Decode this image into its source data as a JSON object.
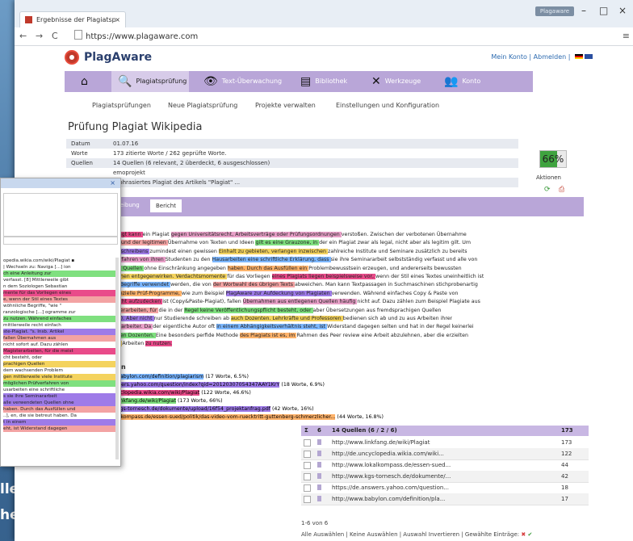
{
  "desktop": {
    "line1": "lle mit",
    "line2": "helle Ein-"
  },
  "browser": {
    "tab_title": "Ergebnisse der Plagiatsp",
    "tab_close": "×",
    "user_chip": "Plagaware",
    "min": "–",
    "max": "□",
    "close": "×",
    "url": "https://www.plagaware.com",
    "nav": {
      "back": "←",
      "forward": "→",
      "reload": "C"
    },
    "menu": "≡"
  },
  "site": {
    "brand": "PlagAware",
    "links": {
      "account": "Mein Konto",
      "sep": " | ",
      "logout": "Abmelden",
      "sep2": " | "
    },
    "mainnav": [
      {
        "icon": "home-icon",
        "glyph": "⌂",
        "label": ""
      },
      {
        "icon": "search-icon",
        "glyph": "🔍",
        "label": "Plagiatsprüfung"
      },
      {
        "icon": "eye-icon",
        "glyph": "👁",
        "label": "Text-Überwachung"
      },
      {
        "icon": "library-icon",
        "glyph": "▤",
        "label": "Bibliothek"
      },
      {
        "icon": "tools-icon",
        "glyph": "✕",
        "label": "Werkzeuge"
      },
      {
        "icon": "account-icon",
        "glyph": "👥",
        "label": "Konto"
      }
    ],
    "subnav": [
      "Plagiatsprüfungen",
      "Neue Plagiatsprüfung",
      "Projekte verwalten",
      "Einstellungen und Konfiguration"
    ],
    "page_title": "Prüfung Plagiat Wikipedia"
  },
  "info": {
    "datum_label": "Datum",
    "datum": "01.07.16",
    "worte_label": "Worte",
    "worte": "173 zitierte Worte / 262 geprüfte Worte.",
    "quellen_label": "Quellen",
    "quellen": "14 Quellen (6 relevant, 2 überdeckt, 6 ausgeschlossen)",
    "projekt": "emoprojekt",
    "beschreibung": "raphrasiertes Plagiat des Artikels \"Plagiat\" ...",
    "percent": "66%",
    "aktionen": "Aktionen"
  },
  "tabs": [
    "schreibung",
    "Bericht"
  ],
  "report": {
    "heading": "ext",
    "lines": [
      "Unbefugt kann ein Plagiat gegen Universitätsrecht, Arbeitsverträge oder Prüfungsordnungen verstoßen. Zwischen der verbotenen Übernahme",
      "ungen und der legitimen Übernahme von Texten und Ideen gilt es eine Grauzone, in der ein Plagiat zwar als legal, nicht aber als legitim gilt. Um",
      "des Abschreibens zumindest einen gewissen Einhalt zu gebieten, verlangen inzwischen zahlreiche Institute und Seminare zusätzlich zu bereits",
      "Prüfverfahren von ihren Studenten zu den Hausarbeiten eine schriftliche Erklärung, dass sie ihre Seminararbeit selbstständig verfasst und alle von",
      "ndeten Quellen ohne Einschränkung angegeben haben. Durch das Ausfüllen ein Problembewusstsein erzeugen, und andererseits bewussten",
      "versuchen entgegenwirken. Verdachtsmomente für das Vorliegen eines Plagiats liegen beispielsweise vor, wenn der Stil eines Textes uneinheitlich ist",
      "tische Begriffe verwendet werden, die von der Wortwahl des übrigen Texts abweichen. Man kann Textpassagen in Suchmaschinen stichprobenartig",
      "der spezielle Prüf-Programme, wie zum Beispiel PlagAware zur Aufdeckung von Plagiaten verwenden. Während einfaches Copy & Paste von",
      "cht leicht aufzudecken ist (Copy&Paste-Plagiat), fallen Übernahmen aus entlegenen Quellen häufig nicht auf. Dazu zählen zum Beispiel Plagiate aus",
      "Magisterarbeiten, für die in der Regel keine Veröffentlichungspflicht besteht, oder aber Übersetzungen aus fremdsprachigen Quellen",
      "plagiat). Aber nicht nur Studierende schreiben ab auch Dozenten. Lehrkräfte und Professoren bedienen sich ab und zu aus Arbeiten ihrer",
      "der Mitarbeiter. Da der eigentliche Autor oft in einem Abhängigkeitsverhältnis steht, ist Widerstand dagegen selten und hat in der Regel keinerlei",
      "n für den Dozenten. Eine besonders perfide Methode des Plagiats ist es, im Rahmen des Peer review eine Arbeit abzulehnen, aber die erzielten",
      "eigene Arbeiten zu nutzen."
    ]
  },
  "sources": {
    "heading": "uellen",
    "lines": [
      "www.babylon.com/definition/plagiarism (17 Worte, 6.5%)",
      "e.answers.yahoo.com/question/index?qid=20120307054347AAY1KrY (18 Worte, 6.9%)",
      "e.uncyclopedia.wikia.com/wiki/Plagiat (122 Worte, 46.6%)",
      "www.linkfang.de/wiki/Plagiat (173 Worte, 66%)",
      "www.kgs-tornesch.de/dokumente/upload/16f54_projektanfrag.pdf (42 Worte, 16%)",
      "w.lokalkompass.de/essen-sued/politik/das-video-vom-ruecktritt-guttenberg-schmerzlicher... (44 Worte, 16.8%)"
    ]
  },
  "table": {
    "header": {
      "toggle": "Σ",
      "count": "6",
      "label": "14 Quellen (6 / 2 / 6)",
      "words": "173",
      "percent": "66%"
    },
    "rows": [
      {
        "url": "http://www.linkfang.de/wiki/Plagiat",
        "words": "173",
        "percent": "66%"
      },
      {
        "url": "http://de.uncyclopedia.wikia.com/wiki...",
        "words": "122",
        "percent": "46.6%"
      },
      {
        "url": "http://www.lokalkompass.de/essen-sued...",
        "words": "44",
        "percent": "16.8%"
      },
      {
        "url": "http://www.kgs-tornesch.de/dokumente/...",
        "words": "42",
        "percent": "16%"
      },
      {
        "url": "https://de.answers.yahoo.com/question...",
        "words": "18",
        "percent": "6.9%"
      },
      {
        "url": "http://www.babylon.com/definition/pla...",
        "words": "17",
        "percent": "6.5%"
      }
    ],
    "pager": "1-6 von 6",
    "footer": "Alle Auswählen | Keine Auswählen | Auswahl Invertieren | Gewählte Einträge:"
  },
  "popup": {
    "close": "×",
    "lines": [
      "opedia.wikia.com/wiki/Plagiat ▪",
      "| Wechseln zu: Naviga [...] ion",
      "ch eine Anleitung zur",
      "verfasst. [8] Mittlerweile gibt",
      "n dem Soziologen Sebastian",
      "mente für das Vorliegen eines",
      "e, wenn der Stil eines Textes",
      "wöhnliche Begriffe, \"wie \"",
      "ranzologische [...] ogramme zur",
      "zu nutzen. Während einfaches",
      "mittlerweile recht einfach",
      "ste-Plagiat. \"s. Insb. Artikel",
      "fallen Übernahmen aus",
      "nicht sofort auf. Dazu zählen",
      "Magisterarbeiten, für die meist",
      "cht besteht, oder",
      "prachigen Quellen",
      "dem wachsenden Problem",
      "gen mittlerweile viele Institute",
      "möglichen Prüfverfahren von",
      "usarbeiten eine schriftliche",
      "s sie ihre Seminararbeit",
      "alle verwendeten Quellen ohne",
      "haben. Durch das Ausfüllen und",
      "..], en, die sie betreut haben. Da",
      "t in einem",
      "eht, ist Widerstand dagegen"
    ]
  },
  "colors": {
    "nav": "#b9a6d8",
    "brand": "#2a3f6d",
    "accent": "#c0392b"
  }
}
